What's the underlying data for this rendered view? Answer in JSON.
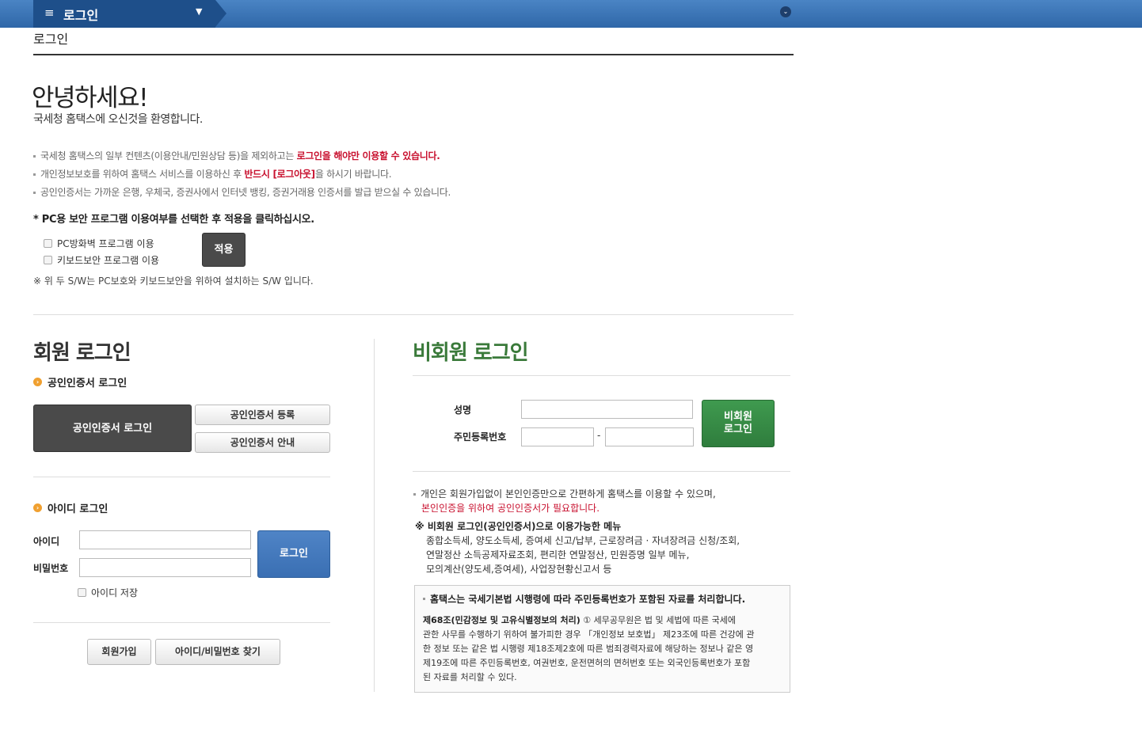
{
  "topbar": {
    "menu_icon": "≡",
    "menu_title": "로그인",
    "caret": "▼",
    "toggle_icon": "⌄"
  },
  "page_title": "로그인",
  "greeting": {
    "hello": "안녕하세요!",
    "welcome": "국세청 홈택스에 오신것을 환영합니다."
  },
  "notices": [
    {
      "pre": "국세청 홈택스의 일부 컨텐츠(이용안내/민원상담 등)을 제외하고는 ",
      "emph": "로그인을 해야만 이용할 수 있습니다.",
      "post": ""
    },
    {
      "pre": "개인정보보호를 위하여 홈택스 서비스를 이용하신 후 ",
      "emph": "반드시 [로그아웃]",
      "post": "을 하시기 바랍니다."
    },
    {
      "pre": "공인인증서는 가까운 은행, 우체국, 증권사에서 인터넷 뱅킹, 증권거래용 인증서를 발급 받으실 수 있습니다.",
      "emph": "",
      "post": ""
    }
  ],
  "security": {
    "heading": "* PC용 보안 프로그램 이용여부를 선택한 후 적용을 클릭하십시오.",
    "firewall_label": "PC방화벽 프로그램 이용",
    "keyboard_label": "키보드보안 프로그램 이용",
    "apply_label": "적용",
    "note": "※ 위 두 S/W는 PC보호와 키보드보안을 위하여 설치하는 S/W 입니다."
  },
  "member": {
    "title": "회원 로그인",
    "cert_section": "공인인증서 로그인",
    "cert_login_btn": "공인인증서 로그인",
    "cert_register_btn": "공인인증서 등록",
    "cert_guide_btn": "공인인증서 안내",
    "id_section": "아이디 로그인",
    "id_label": "아이디",
    "pw_label": "비밀번호",
    "login_btn": "로그인",
    "save_id_label": "아이디 저장",
    "signup_btn": "회원가입",
    "find_btn": "아이디/비밀번호 찾기"
  },
  "nonmember": {
    "title": "비회원 로그인",
    "name_label": "성명",
    "rrn_label": "주민등록번호",
    "dash": "-",
    "login_btn_line1": "비회원",
    "login_btn_line2": "로그인",
    "note_line1": "개인은 회원가입없이 본인인증만으로 간편하게 홈택스를 이용할 수 있으며,",
    "note_line2": "본인인증을 위하여 공인인증서가 필요합니다.",
    "avail_heading": "※ 비회원 로그인(공인인증서)으로 이용가능한 메뉴",
    "avail_lines": [
      "종합소득세, 양도소득세, 증여세 신고/납부, 근로장려금 · 자녀장려금 신청/조회,",
      "연말정산 소득공제자료조회, 편리한 연말정산, 민원증명 일부 메뉴,",
      "모의계산(양도세,증여세), 사업장현황신고서 등"
    ],
    "box_heading": "홈택스는 국세기본법 시행령에 따라 주민등록번호가 포함된 자료를 처리합니다.",
    "box_bold": "제68조(민감정보 및 고유식별정보의 처리)",
    "box_lines": [
      " ① 세무공무원은 법 및 세법에 따른 국세에",
      "관한 사무를 수행하기 위하여 불가피한 경우 「개인정보 보호법」 제23조에 따른 건강에 관",
      "한 정보 또는 같은 법 시행령 제18조제2호에 따른 범죄경력자료에 해당하는 정보나 같은 영",
      "제19조에 따른 주민등록번호, 여권번호, 운전면허의 면허번호 또는 외국인등록번호가 포함",
      "된 자료를 처리할 수 있다."
    ]
  }
}
